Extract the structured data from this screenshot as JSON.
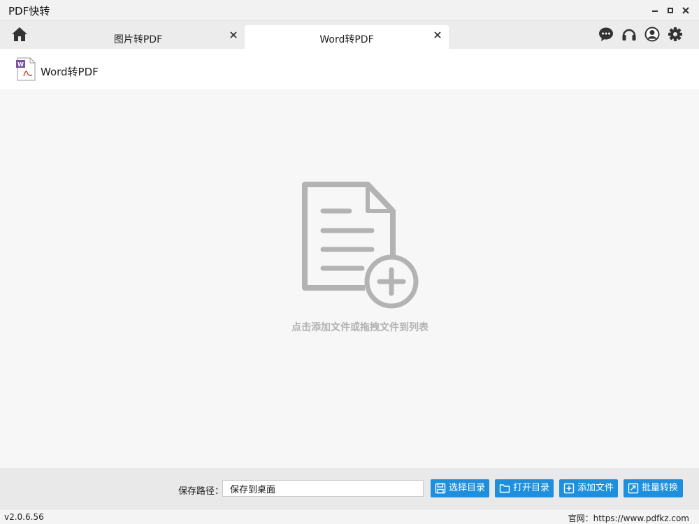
{
  "window": {
    "title": "PDF快转"
  },
  "tabs": [
    {
      "label": "图片转PDF",
      "active": false
    },
    {
      "label": "Word转PDF",
      "active": true
    }
  ],
  "page": {
    "title": "Word转PDF"
  },
  "dropzone": {
    "hint": "点击添加文件或拖拽文件到列表"
  },
  "toolbar": {
    "save_path_label": "保存路径：",
    "save_path_value": "保存到桌面",
    "select_dir_label": "选择目录",
    "open_dir_label": "打开目录",
    "add_file_label": "添加文件",
    "batch_convert_label": "批量转换"
  },
  "status": {
    "version": "v2.0.6.56",
    "website": "官网：https://www.pdfkz.com"
  },
  "colors": {
    "accent": "#1e8fdd",
    "icon_gray": "#b3b3b3",
    "word_purple": "#7b4ea8"
  },
  "icons": {
    "home": "home-icon",
    "chat": "chat-icon",
    "support": "headset-icon",
    "user": "user-icon",
    "settings": "gear-icon"
  }
}
